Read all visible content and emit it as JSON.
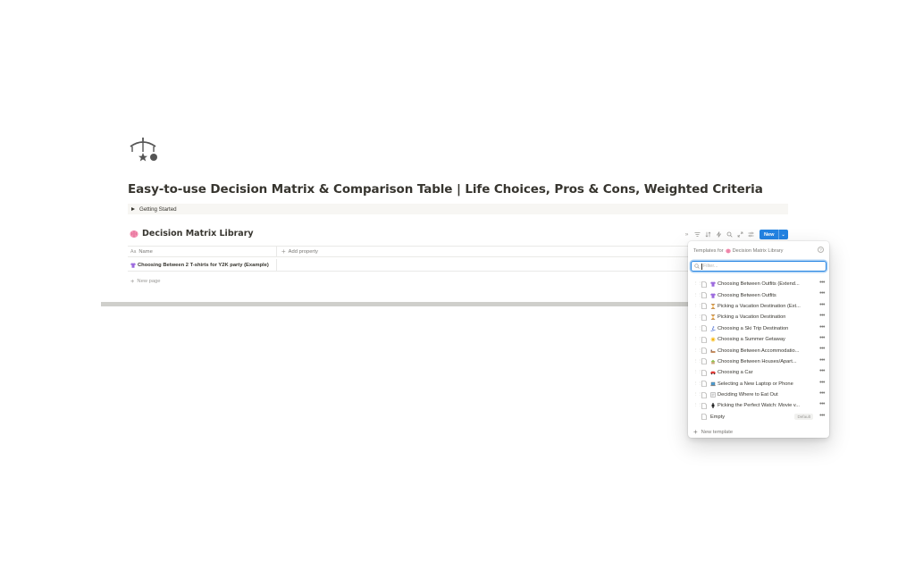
{
  "page": {
    "icon": "mobile-icon",
    "title": "Easy-to-use Decision Matrix & Comparison Table | Life Choices, Pros & Cons, Weighted Criteria",
    "toggle_label": "Getting Started"
  },
  "database": {
    "icon": "brain-icon",
    "title": "Decision Matrix Library",
    "toolbar": {
      "new_label": "New"
    },
    "columns": {
      "name_type": "Aa",
      "name": "Name",
      "add_property": "Add property"
    },
    "rows": [
      {
        "icon": "tshirt-icon",
        "name": "Choosing Between 2 T-shirts for Y2K party (Example)"
      }
    ],
    "new_page_label": "New page"
  },
  "templates_popup": {
    "header_prefix": "Templates for",
    "header_db": "Decision Matrix Library",
    "filter_placeholder": "Filter...",
    "items": [
      {
        "icon": "tshirt-icon",
        "name": "Choosing Between Outfits (Extend..."
      },
      {
        "icon": "tshirt-icon",
        "name": "Choosing Between Outfits"
      },
      {
        "icon": "hourglass-icon",
        "name": "Picking a Vacation Destination (Ext..."
      },
      {
        "icon": "hourglass-icon",
        "name": "Picking a Vacation Destination"
      },
      {
        "icon": "skier-icon",
        "name": "Choosing a Ski Trip Destination"
      },
      {
        "icon": "sun-icon",
        "name": "Choosing a Summer Getaway"
      },
      {
        "icon": "hotel-icon",
        "name": "Choosing Between Accommodatio..."
      },
      {
        "icon": "house-icon",
        "name": "Choosing Between Houses/Apart..."
      },
      {
        "icon": "car-icon",
        "name": "Choosing a Car"
      },
      {
        "icon": "laptop-icon",
        "name": "Selecting a New Laptop or Phone"
      },
      {
        "icon": "menu-card-icon",
        "name": "Deciding Where to Eat Out"
      },
      {
        "icon": "watch-icon",
        "name": "Picking the Perfect Watch: Movie v..."
      }
    ],
    "empty_item": {
      "name": "Empty",
      "badge": "Default"
    },
    "new_template_label": "New template"
  }
}
